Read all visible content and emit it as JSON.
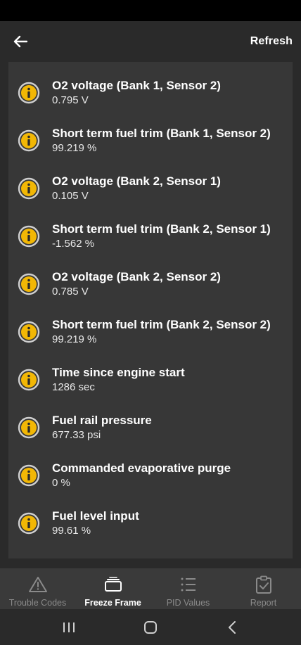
{
  "app_bar": {
    "refresh_label": "Refresh"
  },
  "items": [
    {
      "name": "O2 voltage (Bank 1, Sensor 2)",
      "value": "0.795 V"
    },
    {
      "name": "Short term fuel trim (Bank 1, Sensor 2)",
      "value": "99.219 %"
    },
    {
      "name": "O2 voltage (Bank 2, Sensor 1)",
      "value": "0.105 V"
    },
    {
      "name": "Short term fuel trim (Bank 2, Sensor 1)",
      "value": "-1.562 %"
    },
    {
      "name": "O2 voltage (Bank 2, Sensor 2)",
      "value": "0.785 V"
    },
    {
      "name": "Short term fuel trim (Bank 2, Sensor 2)",
      "value": "99.219 %"
    },
    {
      "name": "Time since engine start",
      "value": "1286 sec"
    },
    {
      "name": "Fuel rail pressure",
      "value": "677.33 psi"
    },
    {
      "name": "Commanded evaporative purge",
      "value": "0 %"
    },
    {
      "name": "Fuel level input",
      "value": "99.61 %"
    }
  ],
  "bottom_nav": {
    "tabs": [
      {
        "label": "Trouble Codes",
        "icon": "warning-icon",
        "active": false
      },
      {
        "label": "Freeze Frame",
        "icon": "freeze-frame-icon",
        "active": true
      },
      {
        "label": "PID Values",
        "icon": "list-icon",
        "active": false
      },
      {
        "label": "Report",
        "icon": "clipboard-check-icon",
        "active": false
      }
    ]
  },
  "colors": {
    "accent": "#f2b705",
    "background": "#2a2a2a",
    "card": "#373737",
    "nav": "#3a3a3a"
  }
}
